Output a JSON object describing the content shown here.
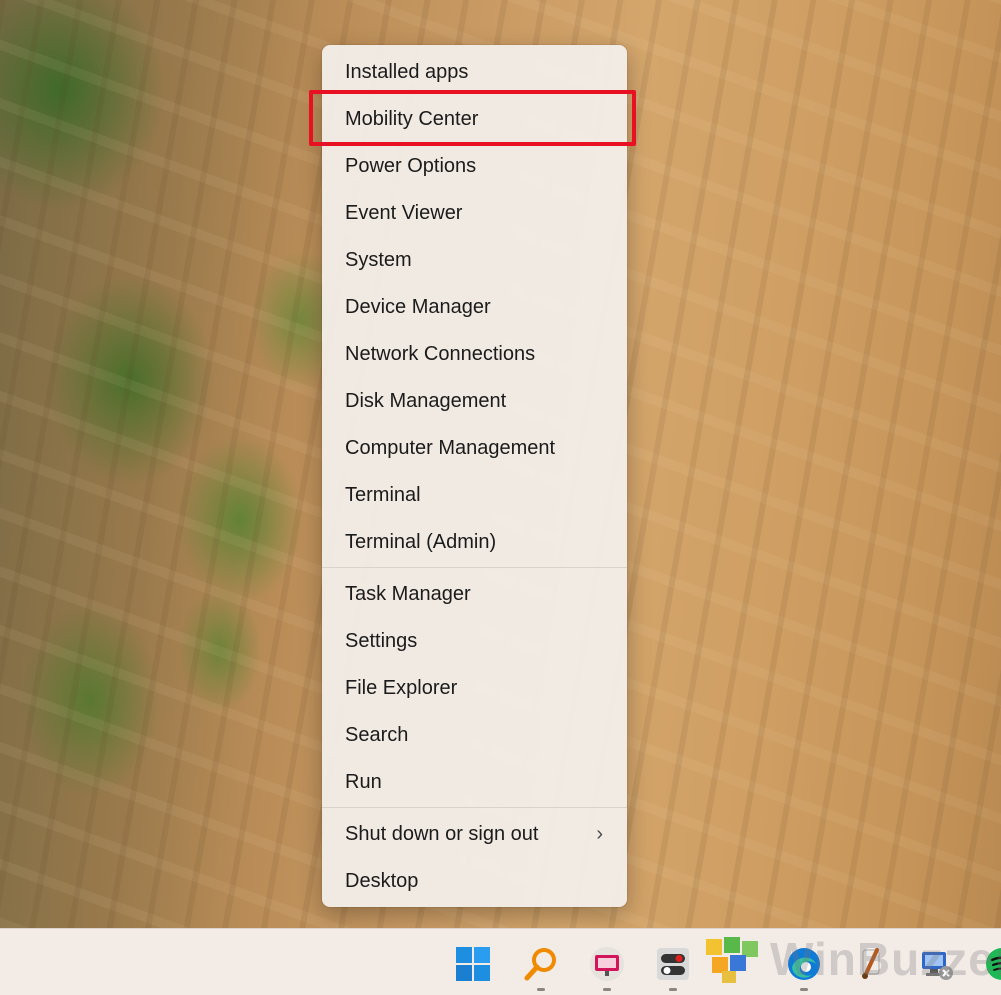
{
  "context_menu": {
    "items": [
      {
        "label": "Installed apps"
      },
      {
        "label": "Mobility Center",
        "highlighted": true
      },
      {
        "label": "Power Options"
      },
      {
        "label": "Event Viewer"
      },
      {
        "label": "System"
      },
      {
        "label": "Device Manager"
      },
      {
        "label": "Network Connections"
      },
      {
        "label": "Disk Management"
      },
      {
        "label": "Computer Management"
      },
      {
        "label": "Terminal"
      },
      {
        "label": "Terminal (Admin)"
      },
      {
        "label": "Task Manager"
      },
      {
        "label": "Settings"
      },
      {
        "label": "File Explorer"
      },
      {
        "label": "Search"
      },
      {
        "label": "Run"
      },
      {
        "label": "Shut down or sign out",
        "has_submenu": true
      },
      {
        "label": "Desktop"
      }
    ],
    "submenu_chevron": "›"
  },
  "highlight": {
    "color": "#e81123",
    "target": "Mobility Center"
  },
  "taskbar": {
    "icons": [
      {
        "name": "windows-start-icon"
      },
      {
        "name": "search-magnifier-icon"
      },
      {
        "name": "presentation-app-icon"
      },
      {
        "name": "toggle-app-icon"
      },
      {
        "name": "cubes-app-icon"
      },
      {
        "name": "edge-browser-icon"
      },
      {
        "name": "paint-brush-app-icon"
      },
      {
        "name": "network-computer-icon"
      },
      {
        "name": "spotify-icon"
      }
    ]
  },
  "watermark": {
    "text": "WinBuzzer"
  }
}
